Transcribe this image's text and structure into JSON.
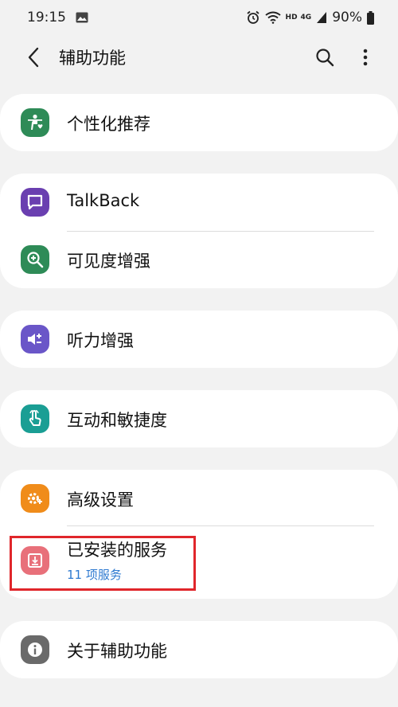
{
  "status": {
    "time": "19:15",
    "hd": "HD",
    "network": "4G",
    "battery": "90%"
  },
  "header": {
    "title": "辅助功能"
  },
  "items": {
    "personalized": "个性化推荐",
    "talkback": "TalkBack",
    "visibility": "可见度增强",
    "hearing": "听力增强",
    "interaction": "互动和敏捷度",
    "advanced": "高级设置",
    "installed": "已安装的服务",
    "installed_sub": "11 项服务",
    "about": "关于辅助功能"
  },
  "colors": {
    "personalized": "#2e8b57",
    "talkback": "#6a3fb0",
    "visibility": "#2e8b57",
    "hearing": "#6a56c8",
    "interaction": "#1a9e94",
    "advanced": "#f08c1a",
    "installed": "#e8707a",
    "about": "#6a6a6a",
    "highlight": "#e0262b",
    "link": "#2d79d0"
  }
}
